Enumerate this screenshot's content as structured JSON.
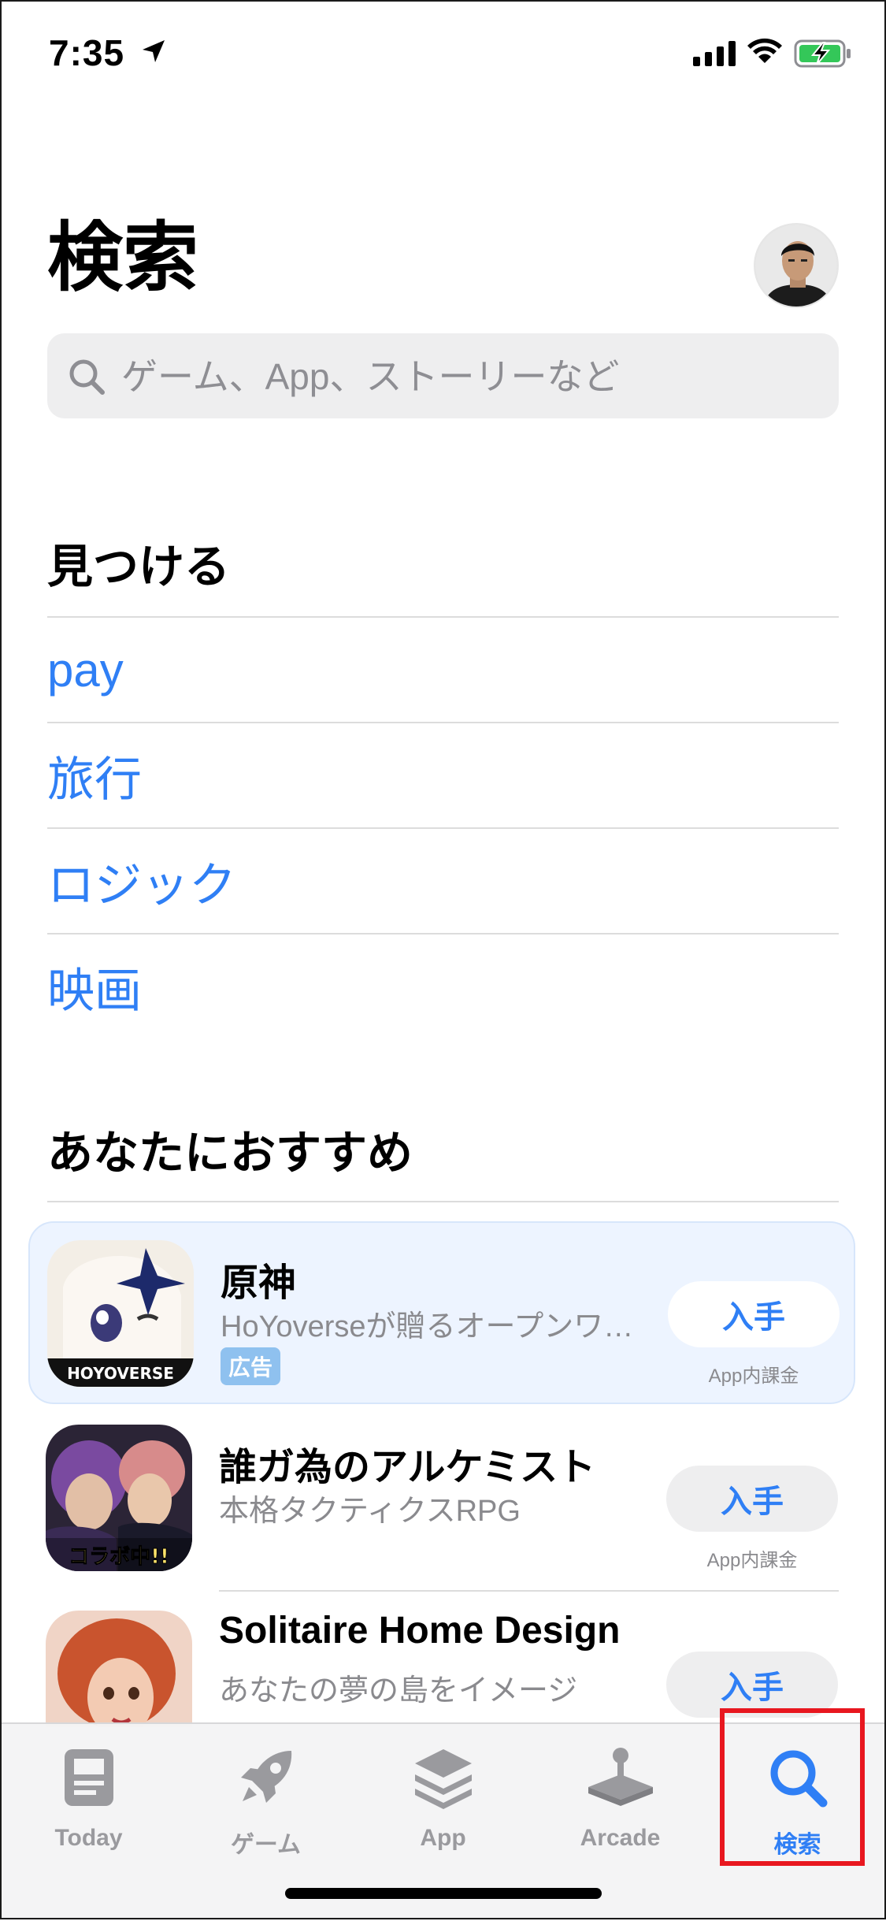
{
  "status_bar": {
    "time": "7:35"
  },
  "header": {
    "title": "検索",
    "search_placeholder": "ゲーム、App、ストーリーなど"
  },
  "discover": {
    "title": "見つける",
    "items": [
      "pay",
      "旅行",
      "ロジック",
      "映画"
    ]
  },
  "recommended": {
    "title": "あなたにおすすめ",
    "apps": [
      {
        "name": "原神",
        "subtitle": "HoYoverseが贈るオープンワールド…",
        "badge": "広告",
        "button": "入手",
        "note": "App内課金",
        "icon_text": "HOYOVERSE"
      },
      {
        "name": "誰ガ為のアルケミスト",
        "subtitle": "本格タクティクスRPG",
        "button": "入手",
        "note": "App内課金",
        "icon_text": "コラボ中!!"
      },
      {
        "name": "Solitaire Home Design",
        "subtitle": "あなたの夢の島をイメージ",
        "button": "入手"
      }
    ]
  },
  "tabs": [
    {
      "label": "Today",
      "icon": "today-icon"
    },
    {
      "label": "ゲーム",
      "icon": "rocket-icon"
    },
    {
      "label": "App",
      "icon": "stack-icon"
    },
    {
      "label": "Arcade",
      "icon": "joystick-icon"
    },
    {
      "label": "検索",
      "icon": "search-icon",
      "active": true
    }
  ],
  "colors": {
    "accent": "#2f7ff5",
    "highlight": "#e8171f"
  }
}
